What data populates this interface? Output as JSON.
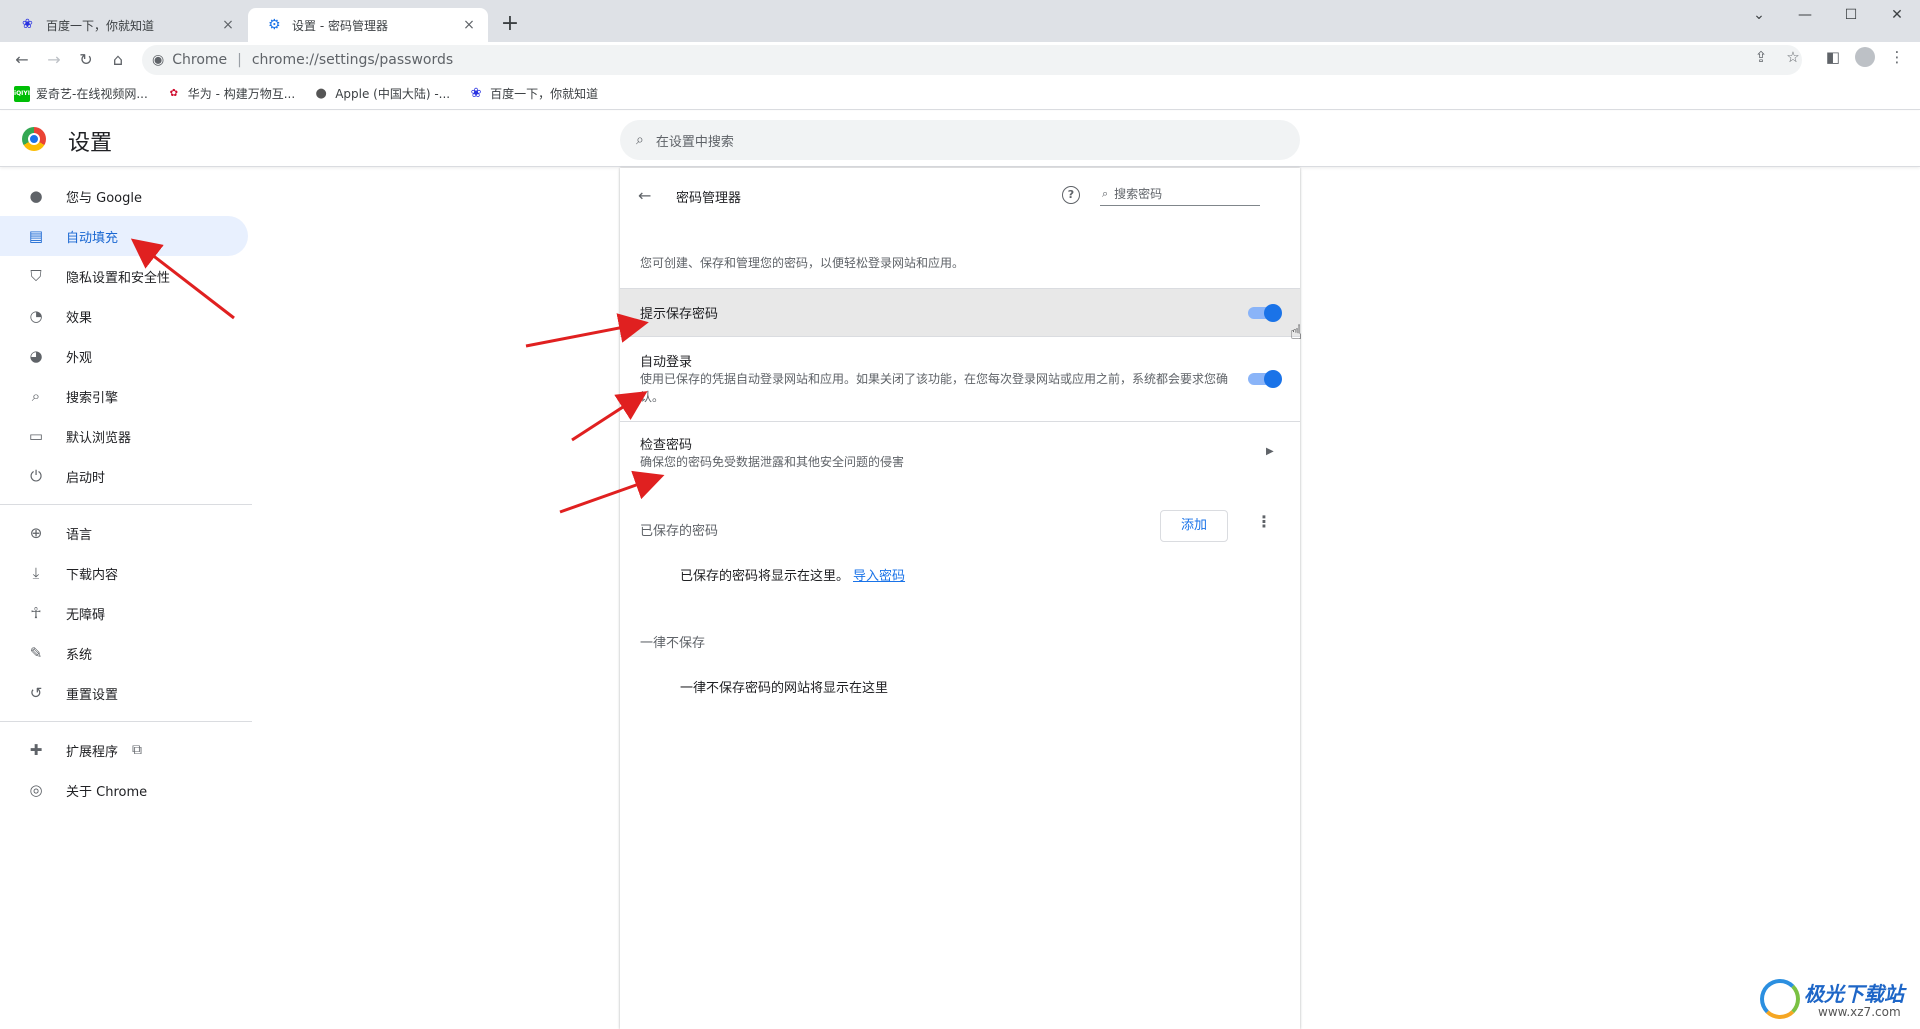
{
  "tabs": [
    {
      "title": "百度一下，你就知道",
      "close": "×"
    },
    {
      "title": "设置 - 密码管理器",
      "close": "×"
    }
  ],
  "new_tab": "+",
  "window_controls": {
    "minimize": "—",
    "maximize": "☐",
    "close": "✕",
    "tab_search": "⌄"
  },
  "toolbar": {
    "back_icon": "arrow-left-icon",
    "forward_icon": "arrow-right-icon",
    "reload_icon": "reload-icon",
    "home_icon": "home-icon",
    "site_name": "Chrome",
    "separator": "|",
    "url": "chrome://settings/passwords"
  },
  "bookmarks": [
    {
      "label": "爱奇艺-在线视频网...",
      "icon": "iqiyi-icon",
      "icon_text": "iQIYI",
      "color": "#00be06"
    },
    {
      "label": "华为 - 构建万物互...",
      "icon": "huawei-icon",
      "icon_text": "✿",
      "color": "#cf0a2c"
    },
    {
      "label": "Apple (中国大陆) -...",
      "icon": "apple-icon",
      "icon_text": "",
      "color": "#555555"
    },
    {
      "label": "百度一下，你就知道",
      "icon": "baidu-icon",
      "icon_text": "❀",
      "color": "#2932e1"
    }
  ],
  "settings_header": {
    "title": "设置",
    "search_placeholder": "在设置中搜索"
  },
  "sidebar": {
    "items": [
      {
        "label": "您与 Google",
        "icon": "person-icon",
        "glyph": "👤",
        "active": false
      },
      {
        "label": "自动填充",
        "icon": "clipboard-icon",
        "glyph": "▤",
        "active": true
      },
      {
        "label": "隐私设置和安全性",
        "icon": "shield-icon",
        "glyph": "⛉",
        "active": false
      },
      {
        "label": "效果",
        "icon": "speedometer-icon",
        "glyph": "◔",
        "active": false
      },
      {
        "label": "外观",
        "icon": "palette-icon",
        "glyph": "🎨",
        "active": false
      },
      {
        "label": "搜索引擎",
        "icon": "search-icon",
        "glyph": "⌕",
        "active": false
      },
      {
        "label": "默认浏览器",
        "icon": "browser-icon",
        "glyph": "▭",
        "active": false
      },
      {
        "label": "启动时",
        "icon": "power-icon",
        "glyph": "⏻",
        "active": false
      }
    ],
    "items2": [
      {
        "label": "语言",
        "icon": "globe-icon",
        "glyph": "🌐"
      },
      {
        "label": "下载内容",
        "icon": "download-icon",
        "glyph": "⤓"
      },
      {
        "label": "无障碍",
        "icon": "accessibility-icon",
        "glyph": "♿"
      },
      {
        "label": "系统",
        "icon": "wrench-icon",
        "glyph": "🔧"
      },
      {
        "label": "重置设置",
        "icon": "history-icon",
        "glyph": "↺"
      }
    ],
    "items3": [
      {
        "label": "扩展程序",
        "icon": "puzzle-icon",
        "glyph": "🧩",
        "external": "⧉"
      },
      {
        "label": "关于 Chrome",
        "icon": "chrome-icon",
        "glyph": "◎"
      }
    ]
  },
  "password_manager": {
    "title": "密码管理器",
    "help_icon": "help-icon",
    "search_placeholder": "搜索密码",
    "description": "您可创建、保存和管理您的密码，以便轻松登录网站和应用。",
    "offer_to_save": {
      "label": "提示保存密码",
      "enabled": true
    },
    "auto_signin": {
      "label": "自动登录",
      "description": "使用已保存的凭据自动登录网站和应用。如果关闭了该功能，在您每次登录网站或应用之前，系统都会要求您确认。",
      "enabled": true
    },
    "check_passwords": {
      "label": "检查密码",
      "description": "确保您的密码免受数据泄露和其他安全问题的侵害"
    },
    "saved_passwords": {
      "label": "已保存的密码",
      "add_button": "添加",
      "empty_text": "已保存的密码将显示在这里。",
      "import_link": "导入密码"
    },
    "never_saved": {
      "label": "一律不保存",
      "empty_text": "一律不保存密码的网站将显示在这里"
    }
  },
  "watermark": {
    "name": "极光下载站",
    "url": "www.xz7.com"
  },
  "colors": {
    "accent": "#1a73e8",
    "active_bg": "#e8f0fe",
    "annotation": "#e02020"
  }
}
